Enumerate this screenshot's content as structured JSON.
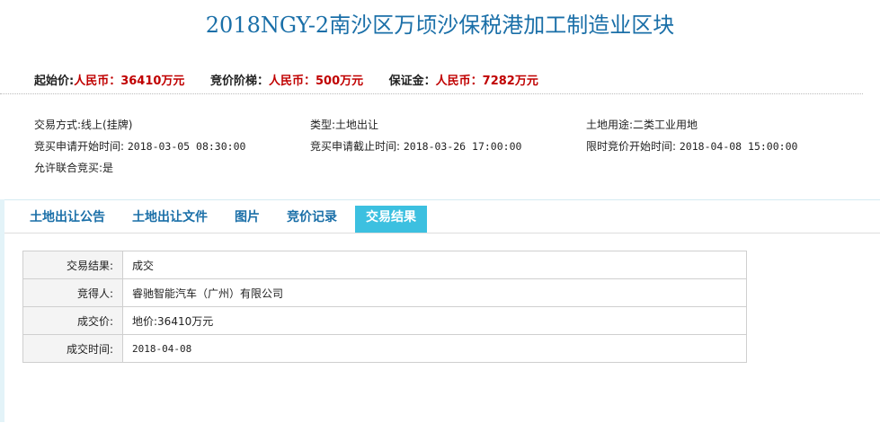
{
  "header": {
    "title": "2018NGY-2南沙区万顷沙保税港加工制造业区块"
  },
  "prices": {
    "start_price_label": "起始价:",
    "start_price_value": "人民币：36410万元",
    "bid_step_label": "竞价阶梯：",
    "bid_step_value": "人民币：500万元",
    "deposit_label": "保证金：",
    "deposit_value": "人民币：7282万元"
  },
  "info": {
    "trade_method_label": "交易方式:",
    "trade_method_value": "线上(挂牌)",
    "type_label": "类型:",
    "type_value": "土地出让",
    "land_use_label": "土地用途:",
    "land_use_value": "二类工业用地",
    "apply_start_label": "竞买申请开始时间:",
    "apply_start_value": "2018-03-05 08:30:00",
    "apply_end_label": "竞买申请截止时间:",
    "apply_end_value": "2018-03-26 17:00:00",
    "bid_start_label": "限时竞价开始时间:",
    "bid_start_value": "2018-04-08 15:00:00",
    "joint_bid_label": "允许联合竞买:",
    "joint_bid_value": "是"
  },
  "tabs": [
    {
      "label": "土地出让公告",
      "active": false
    },
    {
      "label": "土地出让文件",
      "active": false
    },
    {
      "label": "图片",
      "active": false
    },
    {
      "label": "竞价记录",
      "active": false
    },
    {
      "label": "交易结果",
      "active": true
    }
  ],
  "result_table": [
    {
      "key": "交易结果:",
      "value": "成交"
    },
    {
      "key": "竞得人:",
      "value": "睿驰智能汽车（广州）有限公司"
    },
    {
      "key": "成交价:",
      "value": "地价:36410万元"
    },
    {
      "key": "成交时间:",
      "value": "2018-04-08"
    }
  ],
  "colors": {
    "title": "#1a6fa8",
    "price_value": "#c00000",
    "tab_text": "#1a6fa8",
    "tab_active_bg": "#3cc0e0",
    "panel_bg": "#e3f3f8"
  }
}
